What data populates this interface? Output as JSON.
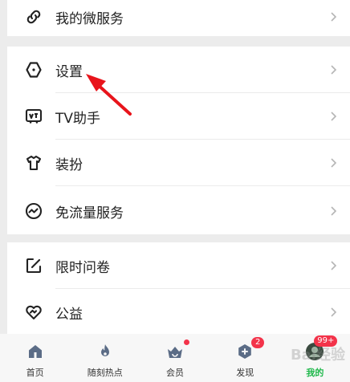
{
  "menu": {
    "micro_service": "我的微服务",
    "settings": "设置",
    "tv_helper": "TV助手",
    "dress_up": "装扮",
    "free_traffic": "免流量服务",
    "survey": "限时问卷",
    "charity": "公益"
  },
  "icons": {
    "micro_service": "link-icon",
    "settings": "hexagon-settings-icon",
    "tv_helper": "tv-icon",
    "dress_up": "tshirt-icon",
    "free_traffic": "wave-circle-icon",
    "survey": "edit-square-icon",
    "charity": "heart-icon",
    "chevron": "chevron-right-icon"
  },
  "tabbar": {
    "tabs": [
      {
        "label": "首页",
        "icon": "home-icon"
      },
      {
        "label": "随刻热点",
        "icon": "flame-icon"
      },
      {
        "label": "会员",
        "icon": "crown-basket-icon"
      },
      {
        "label": "发现",
        "icon": "discover-icon",
        "badge": "2"
      },
      {
        "label": "我的",
        "icon": "avatar-icon",
        "badge": "99+"
      }
    ],
    "active_index": 4
  },
  "watermark": "Bai经验",
  "colors": {
    "active_green": "#1fb84b",
    "badge_red": "#f3334a",
    "annotation_arrow": "#e8141b"
  }
}
